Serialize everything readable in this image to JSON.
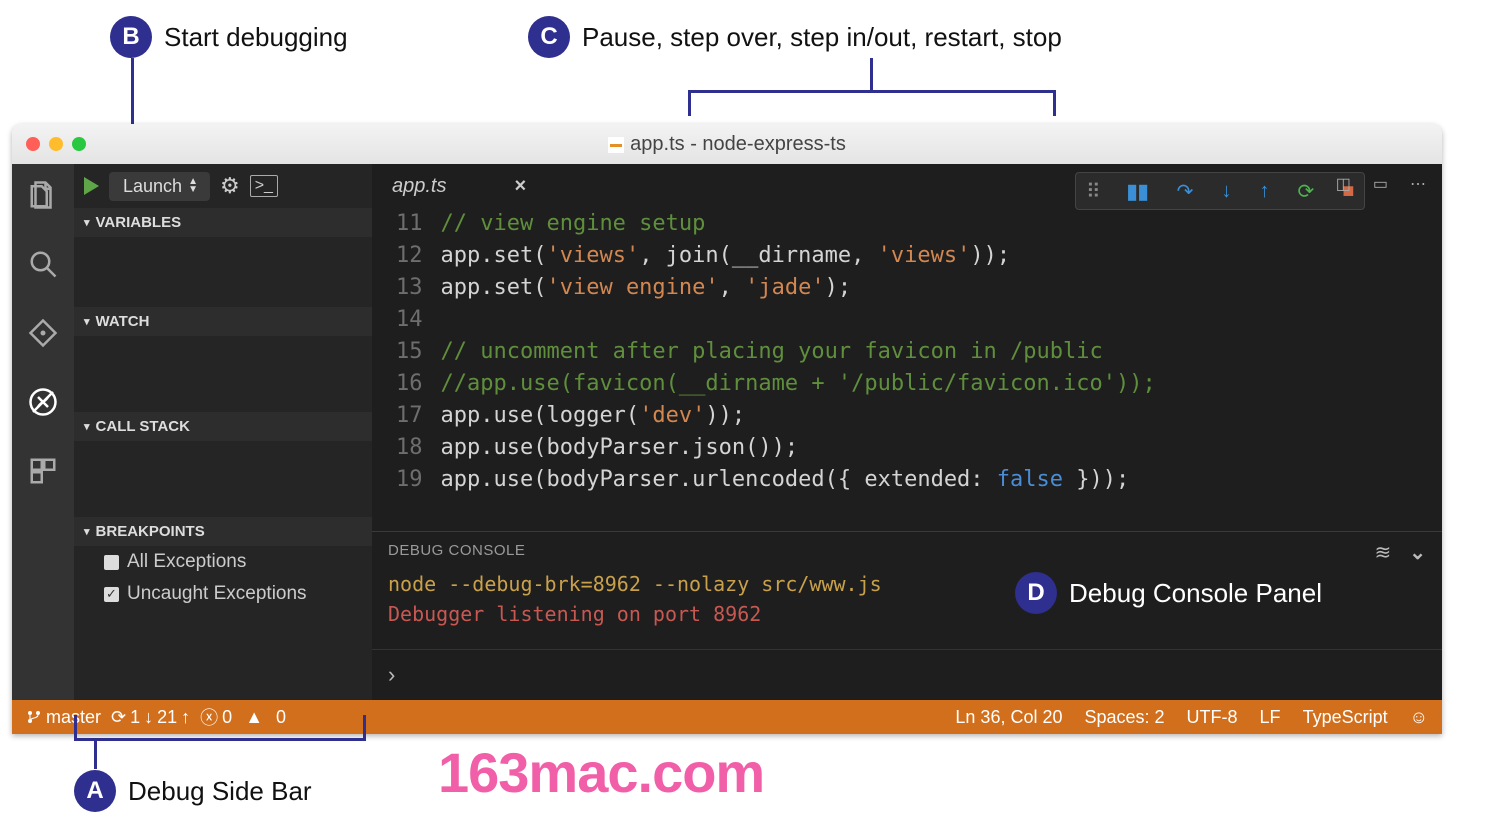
{
  "annotations": {
    "A": {
      "letter": "A",
      "text": "Debug Side Bar"
    },
    "B": {
      "letter": "B",
      "text": "Start debugging"
    },
    "C": {
      "letter": "C",
      "text": "Pause, step over, step in/out, restart, stop"
    },
    "D": {
      "letter": "D",
      "text": "Debug Console Panel"
    }
  },
  "titlebar": {
    "title": "app.ts - node-express-ts"
  },
  "debug_header": {
    "config": "Launch"
  },
  "sidebar": {
    "sections": {
      "variables": "VARIABLES",
      "watch": "WATCH",
      "callstack": "CALL STACK",
      "breakpoints": "BREAKPOINTS"
    },
    "breakpoints": [
      {
        "label": "All Exceptions",
        "checked": false
      },
      {
        "label": "Uncaught Exceptions",
        "checked": true
      }
    ]
  },
  "tab": {
    "label": "app.ts"
  },
  "code": {
    "lines": [
      {
        "n": "11",
        "seg": [
          {
            "t": "// view engine setup",
            "c": "c-comment"
          }
        ]
      },
      {
        "n": "12",
        "seg": [
          {
            "t": "app.set("
          },
          {
            "t": "'views'",
            "c": "c-str"
          },
          {
            "t": ", join(__dirname, "
          },
          {
            "t": "'views'",
            "c": "c-str"
          },
          {
            "t": "));"
          }
        ]
      },
      {
        "n": "13",
        "seg": [
          {
            "t": "app.set("
          },
          {
            "t": "'view engine'",
            "c": "c-str"
          },
          {
            "t": ", "
          },
          {
            "t": "'jade'",
            "c": "c-str"
          },
          {
            "t": ");"
          }
        ]
      },
      {
        "n": "14",
        "seg": [
          {
            "t": ""
          }
        ]
      },
      {
        "n": "15",
        "seg": [
          {
            "t": "// uncomment after placing your favicon in /public",
            "c": "c-comment"
          }
        ]
      },
      {
        "n": "16",
        "seg": [
          {
            "t": "//app.use(favicon(__dirname + '/public/favicon.ico'));",
            "c": "c-comment"
          }
        ]
      },
      {
        "n": "17",
        "seg": [
          {
            "t": "app.use(logger("
          },
          {
            "t": "'dev'",
            "c": "c-str"
          },
          {
            "t": "));"
          }
        ]
      },
      {
        "n": "18",
        "seg": [
          {
            "t": "app.use(bodyParser.json());"
          }
        ]
      },
      {
        "n": "19",
        "seg": [
          {
            "t": "app.use(bodyParser.urlencoded({ extended: "
          },
          {
            "t": "false",
            "c": "c-kw"
          },
          {
            "t": " }));"
          }
        ]
      }
    ]
  },
  "console": {
    "title": "DEBUG CONSOLE",
    "lines": [
      {
        "text": "node --debug-brk=8962 --nolazy src/www.js",
        "cls": "y"
      },
      {
        "text": "Debugger listening on port 8962",
        "cls": "r"
      }
    ],
    "input_prompt": "›"
  },
  "statusbar": {
    "branch": "master",
    "sync_down": "1",
    "sync_up": "21",
    "errors": "0",
    "warnings": "0",
    "ln_col": "Ln 36, Col 20",
    "spaces": "Spaces: 2",
    "encoding": "UTF-8",
    "eol": "LF",
    "lang": "TypeScript"
  },
  "watermark": "163mac.com"
}
